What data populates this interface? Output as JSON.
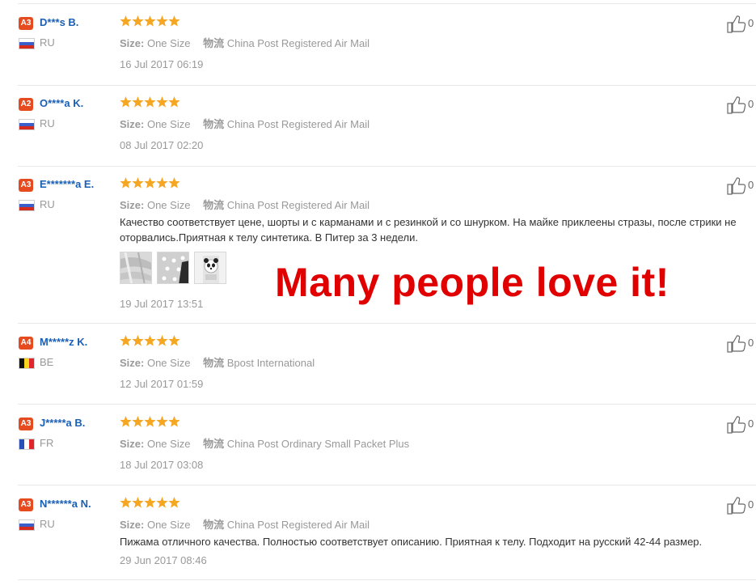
{
  "overlay_text": "Many people love it!",
  "colors": {
    "accent_blue": "#1a5fb4",
    "star": "#f5a623",
    "level_badge": "#e64b1f",
    "overlay": "#e00000"
  },
  "labels": {
    "size_key": "Size:",
    "logistics_key": "物流"
  },
  "reviews": [
    {
      "level": "A3",
      "name": "D***s B.",
      "country": "RU",
      "size": "One Size",
      "shipping": "China Post Registered Air Mail",
      "text": [],
      "date": "16 Jul 2017 06:19",
      "rating": 5,
      "likes": "0",
      "photos": []
    },
    {
      "level": "A2",
      "name": "O****a K.",
      "country": "RU",
      "size": "One Size",
      "shipping": "China Post Registered Air Mail",
      "text": [],
      "date": "08 Jul 2017 02:20",
      "rating": 5,
      "likes": "0",
      "photos": []
    },
    {
      "level": "A3",
      "name": "E*******a E.",
      "country": "RU",
      "size": "One Size",
      "shipping": "China Post Registered Air Mail",
      "text": [
        "Качество соответствует цене, шорты и с карманами и с резинкой и со шнурком. На майке приклеены стразы, после стрики не",
        "оторвались.Приятная к телу синтетика. В Питер за 3 недели."
      ],
      "date": "19 Jul 2017 13:51",
      "rating": 5,
      "likes": "0",
      "photos": [
        "photo-fabric",
        "photo-dots",
        "photo-panda"
      ]
    },
    {
      "level": "A4",
      "name": "M*****z K.",
      "country": "BE",
      "size": "One Size",
      "shipping": "Bpost International",
      "text": [],
      "date": "12 Jul 2017 01:59",
      "rating": 5,
      "likes": "0",
      "photos": []
    },
    {
      "level": "A3",
      "name": "J*****a B.",
      "country": "FR",
      "size": "One Size",
      "shipping": "China Post Ordinary Small Packet Plus",
      "text": [],
      "date": "18 Jul 2017 03:08",
      "rating": 5,
      "likes": "0",
      "photos": []
    },
    {
      "level": "A3",
      "name": "N******a N.",
      "country": "RU",
      "size": "One Size",
      "shipping": "China Post Registered Air Mail",
      "text": [
        "Пижама отличного качества. Полностью соответствует описанию. Приятная к телу. Подходит на русский 42-44 размер."
      ],
      "date": "29 Jun 2017 08:46",
      "rating": 5,
      "likes": "0",
      "photos": []
    }
  ]
}
